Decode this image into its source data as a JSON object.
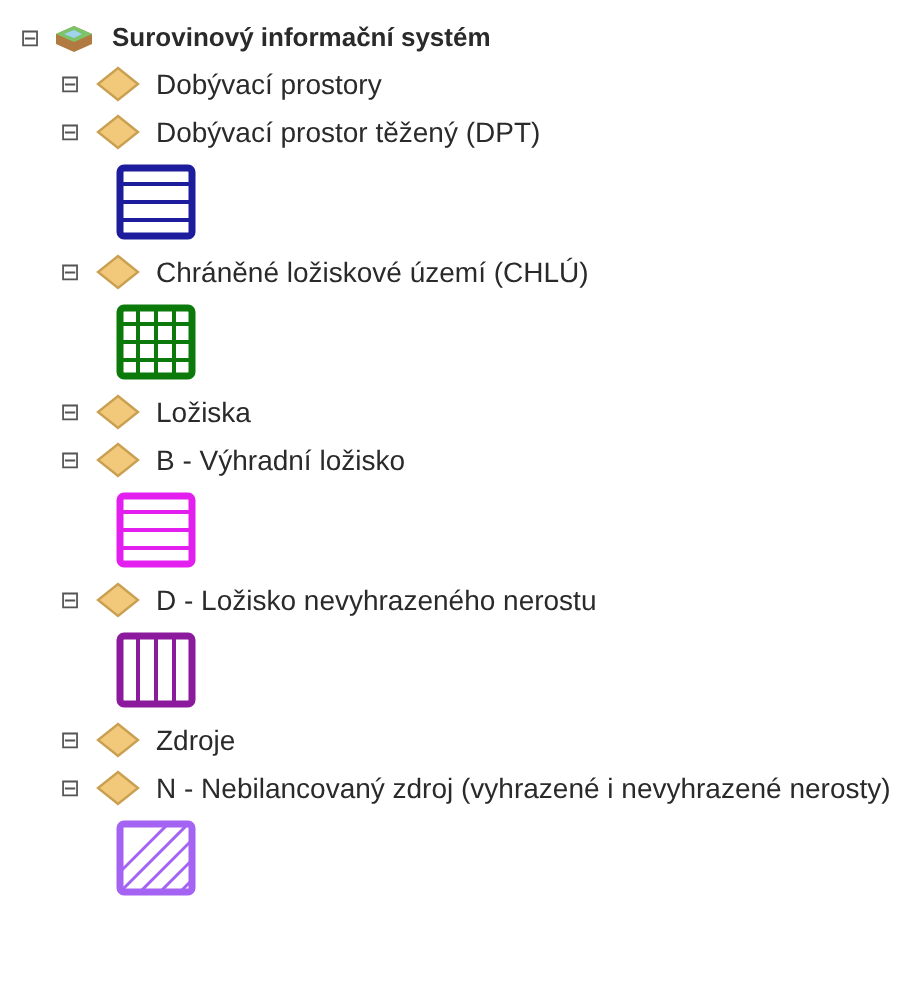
{
  "tree": {
    "label": "Surovinový informační systém",
    "expanded": true,
    "toggle": "⊟",
    "children": [
      {
        "label": "Dobývací prostory",
        "expanded": true,
        "toggle": "⊟"
      },
      {
        "label": "Dobývací prostor těžený (DPT)",
        "expanded": true,
        "toggle": "⊟",
        "symbol": {
          "kind": "horizontal",
          "color": "#1c1c9c"
        }
      },
      {
        "label": "Chráněné ložiskové území (CHLÚ)",
        "expanded": true,
        "toggle": "⊟",
        "symbol": {
          "kind": "grid",
          "color": "#0b7a0b"
        }
      },
      {
        "label": "Ložiska",
        "expanded": true,
        "toggle": "⊟"
      },
      {
        "label": "B - Výhradní ložisko",
        "expanded": true,
        "toggle": "⊟",
        "symbol": {
          "kind": "horizontal",
          "color": "#e31ff0"
        }
      },
      {
        "label": "D - Ložisko nevyhrazeného nerostu",
        "expanded": true,
        "toggle": "⊟",
        "symbol": {
          "kind": "vertical",
          "color": "#8b1a9c"
        }
      },
      {
        "label": "Zdroje",
        "expanded": true,
        "toggle": "⊟"
      },
      {
        "label": "N - Nebilancovaný zdroj (vyhrazené i nevyhrazené nerosty)",
        "expanded": true,
        "toggle": "⊟",
        "symbol": {
          "kind": "diagonal",
          "color": "#a463f2"
        }
      }
    ]
  }
}
